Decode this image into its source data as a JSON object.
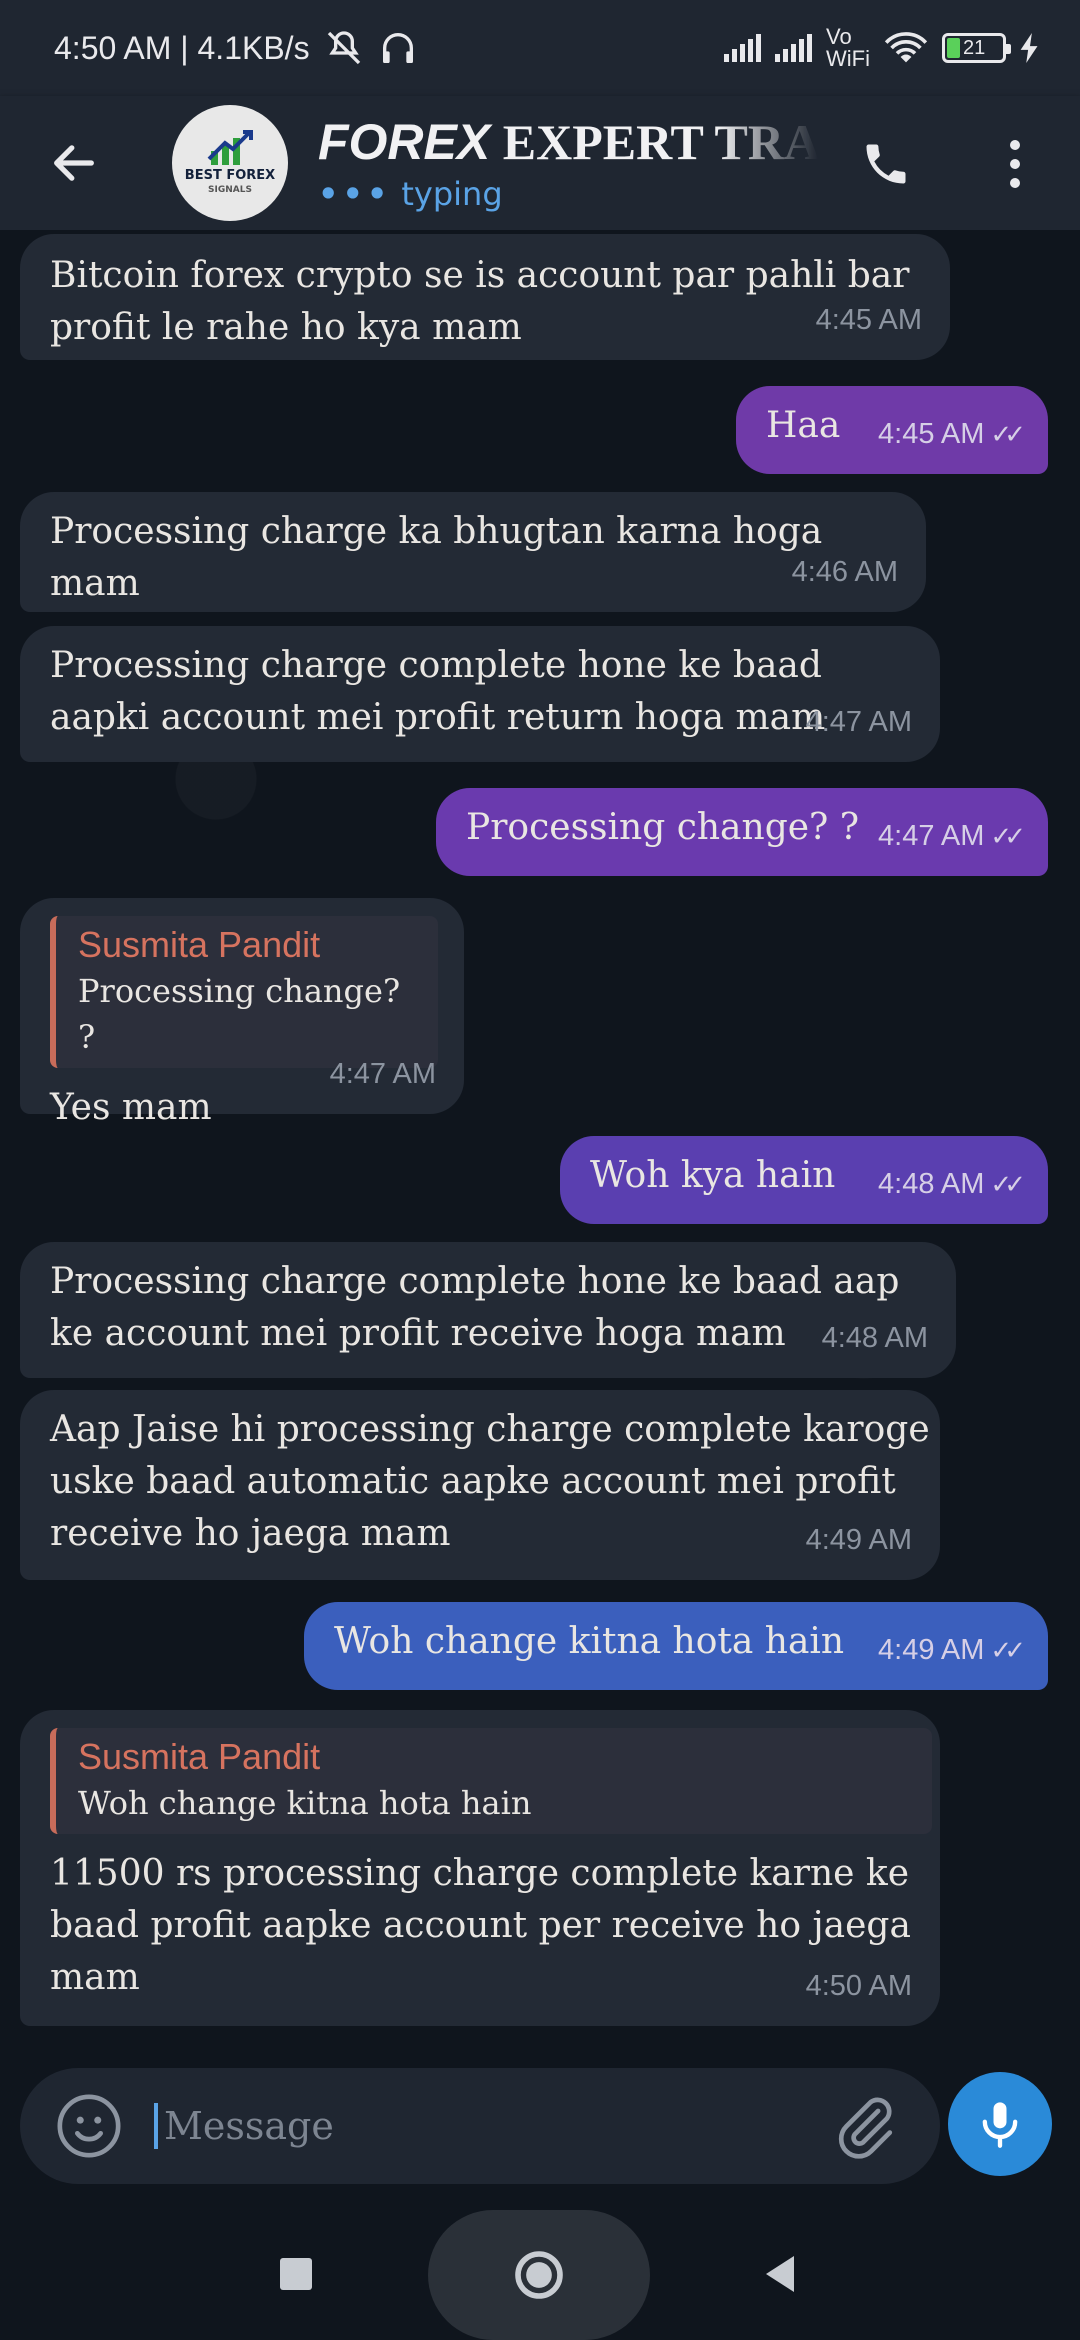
{
  "status": {
    "time_speed": "4:50 AM | 4.1KB/s",
    "volte": "Vo",
    "wifi_label": "WiFi",
    "battery": "21"
  },
  "header": {
    "title_part1": "FOREX",
    "title_part2": " EXPERT TRA",
    "typing": "typing",
    "avatar_text1": "BEST FOREX",
    "avatar_text2": "SIGNALS"
  },
  "messages": [
    {
      "dir": "in",
      "text": "Bitcoin forex crypto se is account par pahli bar profit le rahe ho kya mam",
      "time": "4:45 AM"
    },
    {
      "dir": "out",
      "text": "Haa",
      "time": "4:45 AM"
    },
    {
      "dir": "in",
      "text": "Processing charge ka bhugtan karna hoga mam",
      "time": "4:46 AM"
    },
    {
      "dir": "in",
      "text": "Processing charge complete hone ke baad aapki account mei profit return hoga mam",
      "time": "4:47 AM"
    },
    {
      "dir": "out",
      "text": "Processing change? ?",
      "time": "4:47 AM"
    },
    {
      "dir": "in",
      "quote_name": "Susmita Pandit",
      "quote_text": "Processing change? ?",
      "text": "Yes mam",
      "time": "4:47 AM"
    },
    {
      "dir": "out",
      "text": "Woh kya hain",
      "time": "4:48 AM"
    },
    {
      "dir": "in",
      "text": "Processing charge complete hone ke baad aap ke account mei profit receive hoga mam",
      "time": "4:48 AM"
    },
    {
      "dir": "in",
      "text": "Aap Jaise hi processing charge complete karoge uske baad automatic aapke account mei profit receive ho jaega mam",
      "time": "4:49 AM"
    },
    {
      "dir": "out",
      "text": "Woh change kitna hota hain",
      "time": "4:49 AM"
    },
    {
      "dir": "in",
      "quote_name": "Susmita Pandit",
      "quote_text": "Woh change kitna hota hain",
      "text": "11500 rs processing charge complete karne ke baad profit aapke account per receive ho jaega mam",
      "time": "4:50 AM"
    }
  ],
  "input": {
    "placeholder": "Message"
  },
  "colors": {
    "accent": "#2a8ad8",
    "out_purple": "#6f3aa8",
    "out_violet": "#5a3fb0",
    "out_blue": "#3b5fbd",
    "quote_name": "#d6735f"
  }
}
